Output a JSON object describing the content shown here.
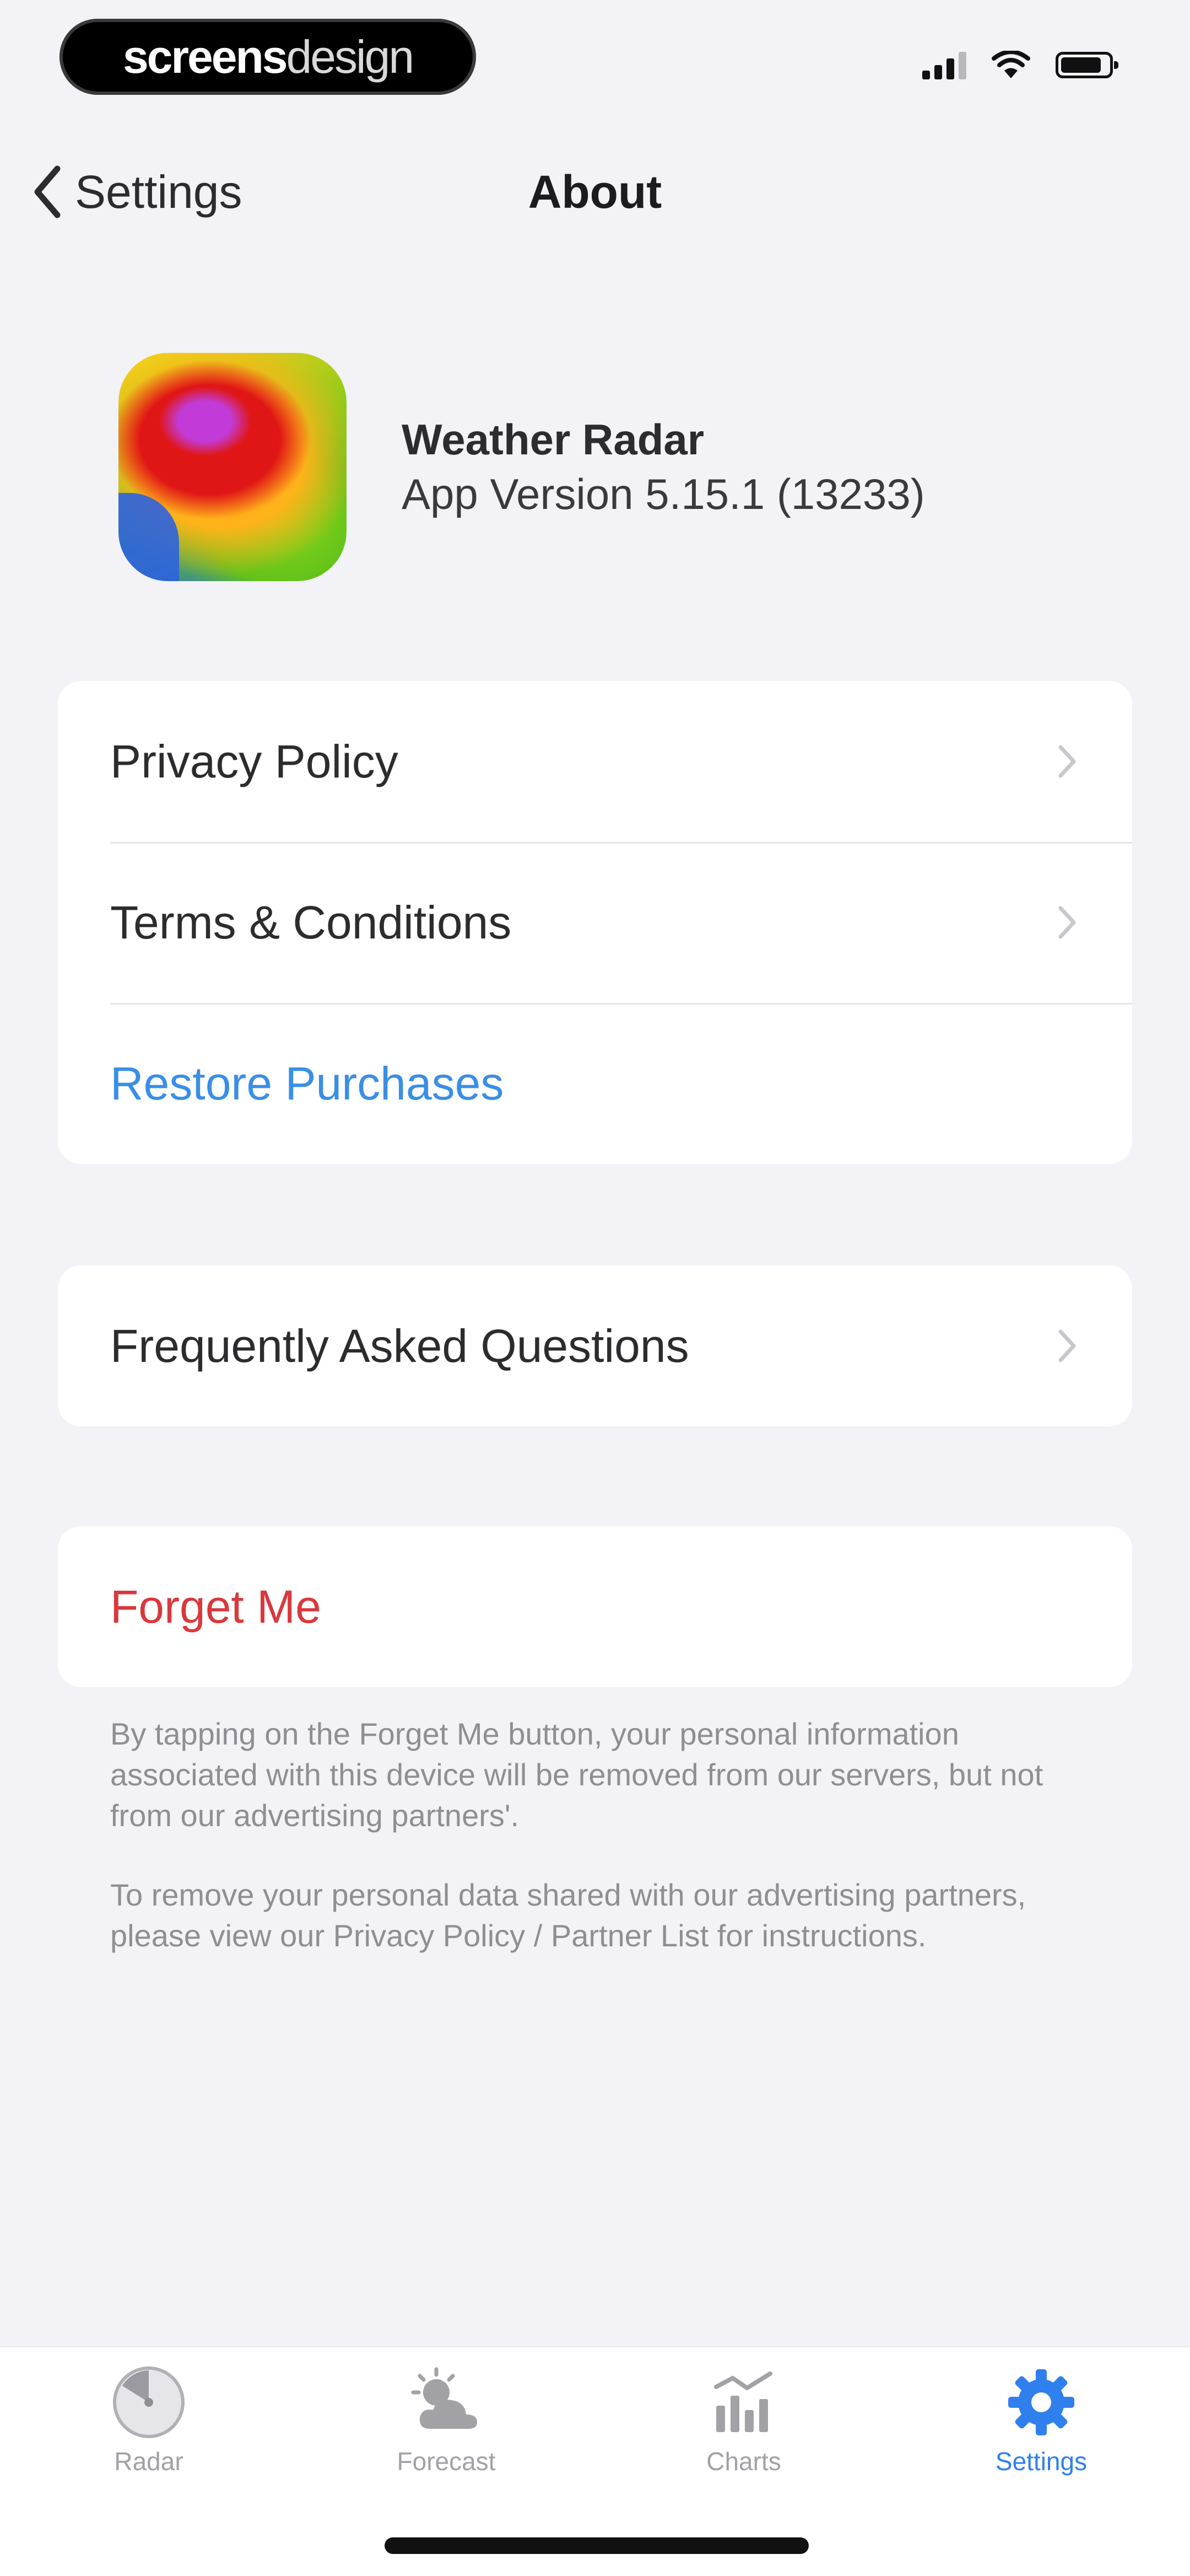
{
  "status_bar": {
    "brand_bold": "screens",
    "brand_light": "design"
  },
  "nav": {
    "back_label": "Settings",
    "title": "About"
  },
  "app": {
    "name": "Weather Radar",
    "version": "App Version 5.15.1 (13233)"
  },
  "legal_group": {
    "items": [
      {
        "label": "Privacy Policy"
      },
      {
        "label": "Terms & Conditions"
      },
      {
        "label": "Restore Purchases"
      }
    ]
  },
  "faq_group": {
    "label": "Frequently Asked Questions"
  },
  "forget_group": {
    "label": "Forget Me",
    "note_1": "By tapping on the Forget Me button, your personal information associated with this device will be removed from our servers, but not from our advertising partners'.",
    "note_2": "To remove your personal data shared with our advertising partners, please view our Privacy Policy / Partner List for instructions."
  },
  "tab_bar": {
    "tabs": [
      {
        "label": "Radar",
        "icon": "radar-icon"
      },
      {
        "label": "Forecast",
        "icon": "forecast-icon"
      },
      {
        "label": "Charts",
        "icon": "charts-icon"
      },
      {
        "label": "Settings",
        "icon": "gear-icon",
        "active": true
      }
    ]
  },
  "colors": {
    "background": "#f2f2f7",
    "link_blue": "#3a8ee6",
    "destructive_red": "#d9383d",
    "active_tab": "#2f80ed"
  }
}
